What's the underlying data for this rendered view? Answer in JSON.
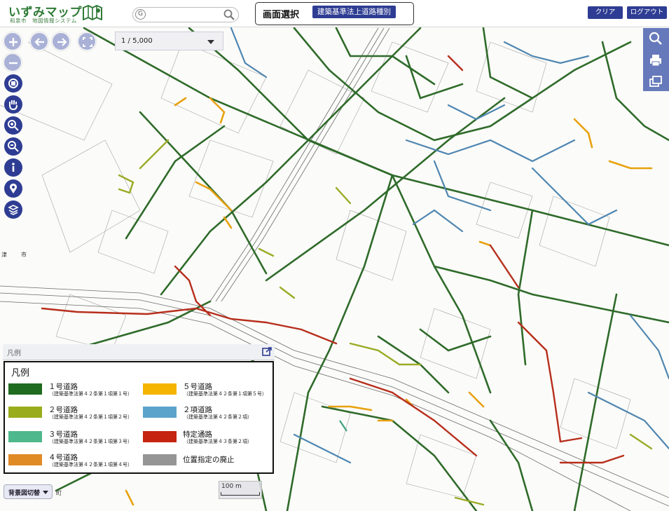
{
  "header": {
    "app_title": "いずみマップ",
    "app_subtitle": "和泉市　地図情報システム",
    "search": {
      "prefix": "G",
      "placeholder": ""
    },
    "screen_select": {
      "label": "画面選択",
      "value": "建築基準法上道路種別"
    },
    "clear_label": "クリア",
    "logout_label": "ログアウト"
  },
  "map": {
    "scale_select": {
      "value": "1 /  5,000"
    },
    "scalebar_label": "100 m",
    "place_labels": [
      "津",
      "市",
      "町"
    ]
  },
  "legend": {
    "header_title": "凡例",
    "title": "凡例",
    "items": [
      {
        "name": "１号道路",
        "note": "（建築基準法第４２条第１項第１号）",
        "color": "#1f6b1f"
      },
      {
        "name": "２号道路",
        "note": "（建築基準法第４２条第１項第２号）",
        "color": "#99ad1c"
      },
      {
        "name": "３号道路",
        "note": "（建築基準法第４２条第１項第３号）",
        "color": "#4fb88c"
      },
      {
        "name": "４号道路",
        "note": "（建築基準法第４２条第１項第４号）",
        "color": "#e08a26"
      },
      {
        "name": "５号道路",
        "note": "（建築基準法第４２条第１項第５号）",
        "color": "#f5b400"
      },
      {
        "name": "２項道路",
        "note": "（建築基準法第４２条第２項）",
        "color": "#5ca3cc"
      },
      {
        "name": "特定通路",
        "note": "（建築基準法第４３条第２項）",
        "color": "#c42410"
      },
      {
        "name": "位置指定の廃止",
        "note": "",
        "color": "#959595"
      }
    ]
  },
  "background_switch_label": "背景図切替",
  "colors": {
    "accent": "#2e3d93",
    "tool_light": "#a9b1d6",
    "panel": "#5a6fb6",
    "logo_green": "#2f7a36"
  },
  "icons": [
    "zoom-in-icon",
    "zoom-out-icon",
    "back-icon",
    "forward-icon",
    "fullscreen-icon",
    "rotate-icon",
    "pan-hand-icon",
    "zoom-area-in-icon",
    "zoom-area-out-icon",
    "info-icon",
    "location-pin-icon",
    "layers-icon",
    "search-icon",
    "print-icon",
    "window-icon",
    "map-icon",
    "export-icon"
  ]
}
